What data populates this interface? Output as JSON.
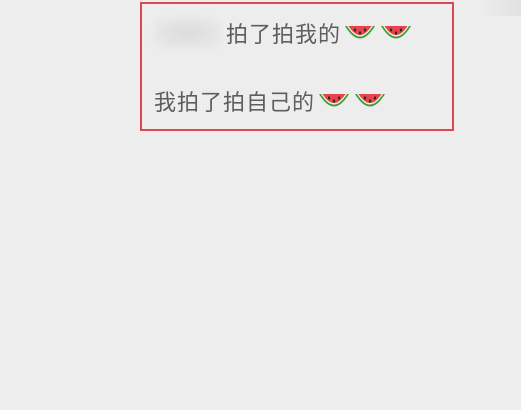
{
  "chat": {
    "messages": [
      {
        "text": "拍了拍我的",
        "sender_name_blurred": true,
        "icons": [
          "watermelon-icon",
          "watermelon-icon"
        ]
      },
      {
        "text": "我拍了拍自己的",
        "sender_name_blurred": false,
        "icons": [
          "watermelon-icon",
          "watermelon-icon"
        ]
      }
    ]
  },
  "colors": {
    "background": "#ededed",
    "text": "#5e5e5e",
    "highlight_border": "#e04553"
  }
}
